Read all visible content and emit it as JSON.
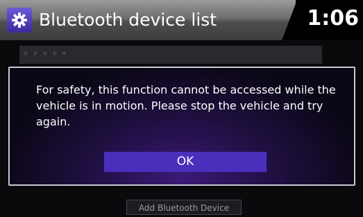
{
  "header": {
    "icon": "gear-icon",
    "title": "Bluetooth device list",
    "clock": "1:06"
  },
  "device_list": {
    "items": [
      {
        "label": "* * * * *"
      }
    ]
  },
  "add_button_label": "Add Bluetooth Device",
  "dialog": {
    "message": "For safety, this function cannot be accessed while the vehicle is in motion. Please stop the vehicle and try again.",
    "ok_label": "OK"
  },
  "colors": {
    "accent": "#4a2fbd",
    "dialog_border": "#c9c9d2",
    "background": "#0c0c10"
  }
}
